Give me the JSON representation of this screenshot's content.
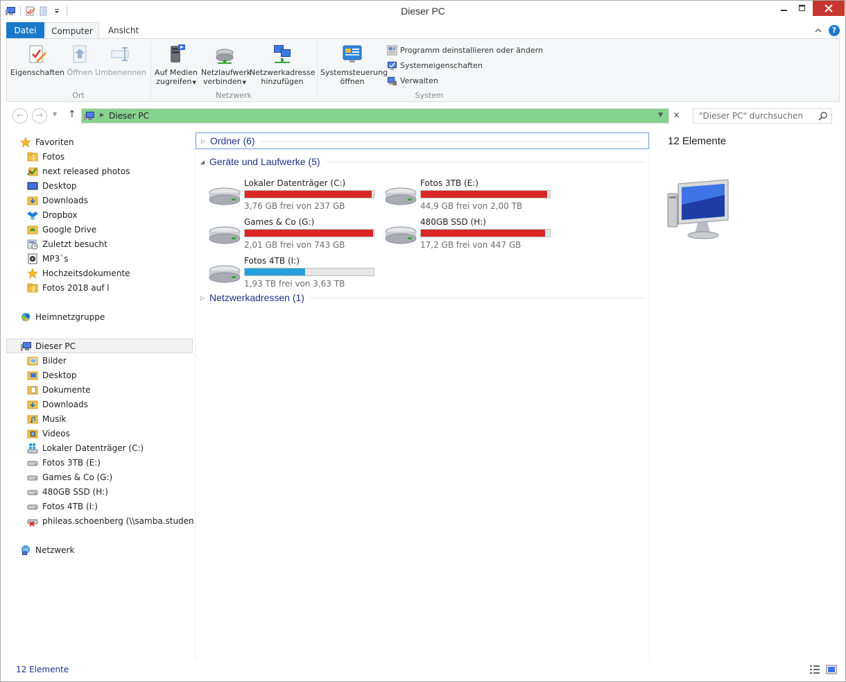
{
  "window": {
    "title": "Dieser PC"
  },
  "ribbon_tabs": {
    "file": "Datei",
    "computer": "Computer",
    "view": "Ansicht",
    "help": "?"
  },
  "ribbon": {
    "ort": {
      "label": "Ort",
      "properties": "Eigenschaften",
      "open": "Öffnen",
      "rename": "Umbenennen"
    },
    "netzwerk": {
      "label": "Netzwerk",
      "media_line1": "Auf Medien",
      "media_line2": "zugreifen",
      "map_line1": "Netzlaufwerk",
      "map_line2": "verbinden",
      "addnet_line1": "Netzwerkadresse",
      "addnet_line2": "hinzufügen"
    },
    "system": {
      "label": "System",
      "control_line1": "Systemsteuerung",
      "control_line2": "öffnen",
      "uninstall": "Programm deinstallieren oder ändern",
      "sysprops": "Systemeigenschaften",
      "manage": "Verwalten"
    }
  },
  "address": {
    "crumb": "Dieser PC",
    "search_placeholder": "\"Dieser PC\" durchsuchen"
  },
  "nav": {
    "favorites_header": "Favoriten",
    "favorites": [
      {
        "label": "Fotos",
        "icon": "folder-icon"
      },
      {
        "label": "next released photos",
        "icon": "shared-folder-icon"
      },
      {
        "label": "Desktop",
        "icon": "desktop-icon"
      },
      {
        "label": "Downloads",
        "icon": "downloads-folder-icon"
      },
      {
        "label": "Dropbox",
        "icon": "dropbox-icon"
      },
      {
        "label": "Google Drive",
        "icon": "google-drive-folder-icon"
      },
      {
        "label": "Zuletzt besucht",
        "icon": "recent-places-icon"
      },
      {
        "label": "MP3`s",
        "icon": "music-file-icon"
      },
      {
        "label": "Hochzeitsdokumente",
        "icon": "star-folder-icon"
      },
      {
        "label": "Fotos 2018 auf l",
        "icon": "folder-icon"
      }
    ],
    "homegroup": "Heimnetzgruppe",
    "this_pc": "Dieser PC",
    "pc_items": [
      {
        "label": "Bilder",
        "icon": "pictures-folder-icon"
      },
      {
        "label": "Desktop",
        "icon": "desktop-folder-icon"
      },
      {
        "label": "Dokumente",
        "icon": "documents-folder-icon"
      },
      {
        "label": "Downloads",
        "icon": "downloads-folder-icon"
      },
      {
        "label": "Musik",
        "icon": "music-folder-icon"
      },
      {
        "label": "Videos",
        "icon": "videos-folder-icon"
      },
      {
        "label": "Lokaler Datenträger (C:)",
        "icon": "windows-drive-icon"
      },
      {
        "label": "Fotos 3TB (E:)",
        "icon": "drive-icon"
      },
      {
        "label": "Games & Co (G:)",
        "icon": "drive-icon"
      },
      {
        "label": "480GB SSD (H:)",
        "icon": "drive-icon"
      },
      {
        "label": "Fotos 4TB (I:)",
        "icon": "drive-icon"
      },
      {
        "label": "phileas.schoenberg (\\\\samba.student.uni",
        "icon": "network-drive-disconnected-icon"
      }
    ],
    "network": "Netzwerk"
  },
  "groups": {
    "folders": "Ordner (6)",
    "devices": "Geräte und Laufwerke (5)",
    "network": "Netzwerkadressen (1)"
  },
  "drives": [
    {
      "name": "Lokaler Datenträger (C:)",
      "info": "3,76 GB frei von 237 GB",
      "used_fraction": 0.984,
      "color": "#da2626"
    },
    {
      "name": "Fotos 3TB (E:)",
      "info": "44,9 GB frei von 2,00 TB",
      "used_fraction": 0.978,
      "color": "#da2626"
    },
    {
      "name": "Games & Co (G:)",
      "info": "2,01 GB frei von 743 GB",
      "used_fraction": 0.997,
      "color": "#da2626"
    },
    {
      "name": "480GB SSD (H:)",
      "info": "17,2 GB frei von 447 GB",
      "used_fraction": 0.962,
      "color": "#da2626"
    },
    {
      "name": "Fotos 4TB (I:)",
      "info": "1,93 TB frei von 3,63 TB",
      "used_fraction": 0.468,
      "color": "#26a0da"
    }
  ],
  "details": {
    "count": "12 Elemente"
  },
  "status": {
    "count": "12 Elemente"
  }
}
